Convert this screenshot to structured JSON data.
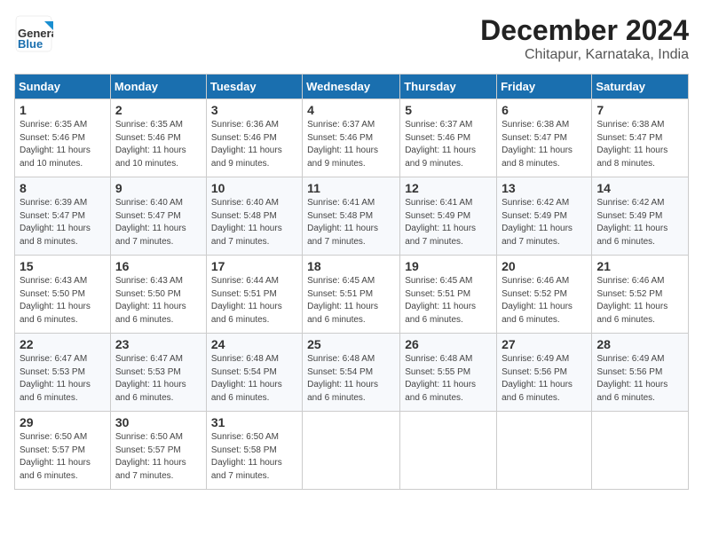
{
  "header": {
    "logo_line1": "General",
    "logo_line2": "Blue",
    "month": "December 2024",
    "location": "Chitapur, Karnataka, India"
  },
  "weekdays": [
    "Sunday",
    "Monday",
    "Tuesday",
    "Wednesday",
    "Thursday",
    "Friday",
    "Saturday"
  ],
  "weeks": [
    [
      {
        "day": "1",
        "sunrise": "6:35 AM",
        "sunset": "5:46 PM",
        "daylight": "11 hours and 10 minutes."
      },
      {
        "day": "2",
        "sunrise": "6:35 AM",
        "sunset": "5:46 PM",
        "daylight": "11 hours and 10 minutes."
      },
      {
        "day": "3",
        "sunrise": "6:36 AM",
        "sunset": "5:46 PM",
        "daylight": "11 hours and 9 minutes."
      },
      {
        "day": "4",
        "sunrise": "6:37 AM",
        "sunset": "5:46 PM",
        "daylight": "11 hours and 9 minutes."
      },
      {
        "day": "5",
        "sunrise": "6:37 AM",
        "sunset": "5:46 PM",
        "daylight": "11 hours and 9 minutes."
      },
      {
        "day": "6",
        "sunrise": "6:38 AM",
        "sunset": "5:47 PM",
        "daylight": "11 hours and 8 minutes."
      },
      {
        "day": "7",
        "sunrise": "6:38 AM",
        "sunset": "5:47 PM",
        "daylight": "11 hours and 8 minutes."
      }
    ],
    [
      {
        "day": "8",
        "sunrise": "6:39 AM",
        "sunset": "5:47 PM",
        "daylight": "11 hours and 8 minutes."
      },
      {
        "day": "9",
        "sunrise": "6:40 AM",
        "sunset": "5:47 PM",
        "daylight": "11 hours and 7 minutes."
      },
      {
        "day": "10",
        "sunrise": "6:40 AM",
        "sunset": "5:48 PM",
        "daylight": "11 hours and 7 minutes."
      },
      {
        "day": "11",
        "sunrise": "6:41 AM",
        "sunset": "5:48 PM",
        "daylight": "11 hours and 7 minutes."
      },
      {
        "day": "12",
        "sunrise": "6:41 AM",
        "sunset": "5:49 PM",
        "daylight": "11 hours and 7 minutes."
      },
      {
        "day": "13",
        "sunrise": "6:42 AM",
        "sunset": "5:49 PM",
        "daylight": "11 hours and 7 minutes."
      },
      {
        "day": "14",
        "sunrise": "6:42 AM",
        "sunset": "5:49 PM",
        "daylight": "11 hours and 6 minutes."
      }
    ],
    [
      {
        "day": "15",
        "sunrise": "6:43 AM",
        "sunset": "5:50 PM",
        "daylight": "11 hours and 6 minutes."
      },
      {
        "day": "16",
        "sunrise": "6:43 AM",
        "sunset": "5:50 PM",
        "daylight": "11 hours and 6 minutes."
      },
      {
        "day": "17",
        "sunrise": "6:44 AM",
        "sunset": "5:51 PM",
        "daylight": "11 hours and 6 minutes."
      },
      {
        "day": "18",
        "sunrise": "6:45 AM",
        "sunset": "5:51 PM",
        "daylight": "11 hours and 6 minutes."
      },
      {
        "day": "19",
        "sunrise": "6:45 AM",
        "sunset": "5:51 PM",
        "daylight": "11 hours and 6 minutes."
      },
      {
        "day": "20",
        "sunrise": "6:46 AM",
        "sunset": "5:52 PM",
        "daylight": "11 hours and 6 minutes."
      },
      {
        "day": "21",
        "sunrise": "6:46 AM",
        "sunset": "5:52 PM",
        "daylight": "11 hours and 6 minutes."
      }
    ],
    [
      {
        "day": "22",
        "sunrise": "6:47 AM",
        "sunset": "5:53 PM",
        "daylight": "11 hours and 6 minutes."
      },
      {
        "day": "23",
        "sunrise": "6:47 AM",
        "sunset": "5:53 PM",
        "daylight": "11 hours and 6 minutes."
      },
      {
        "day": "24",
        "sunrise": "6:48 AM",
        "sunset": "5:54 PM",
        "daylight": "11 hours and 6 minutes."
      },
      {
        "day": "25",
        "sunrise": "6:48 AM",
        "sunset": "5:54 PM",
        "daylight": "11 hours and 6 minutes."
      },
      {
        "day": "26",
        "sunrise": "6:48 AM",
        "sunset": "5:55 PM",
        "daylight": "11 hours and 6 minutes."
      },
      {
        "day": "27",
        "sunrise": "6:49 AM",
        "sunset": "5:56 PM",
        "daylight": "11 hours and 6 minutes."
      },
      {
        "day": "28",
        "sunrise": "6:49 AM",
        "sunset": "5:56 PM",
        "daylight": "11 hours and 6 minutes."
      }
    ],
    [
      {
        "day": "29",
        "sunrise": "6:50 AM",
        "sunset": "5:57 PM",
        "daylight": "11 hours and 6 minutes."
      },
      {
        "day": "30",
        "sunrise": "6:50 AM",
        "sunset": "5:57 PM",
        "daylight": "11 hours and 7 minutes."
      },
      {
        "day": "31",
        "sunrise": "6:50 AM",
        "sunset": "5:58 PM",
        "daylight": "11 hours and 7 minutes."
      },
      null,
      null,
      null,
      null
    ]
  ]
}
